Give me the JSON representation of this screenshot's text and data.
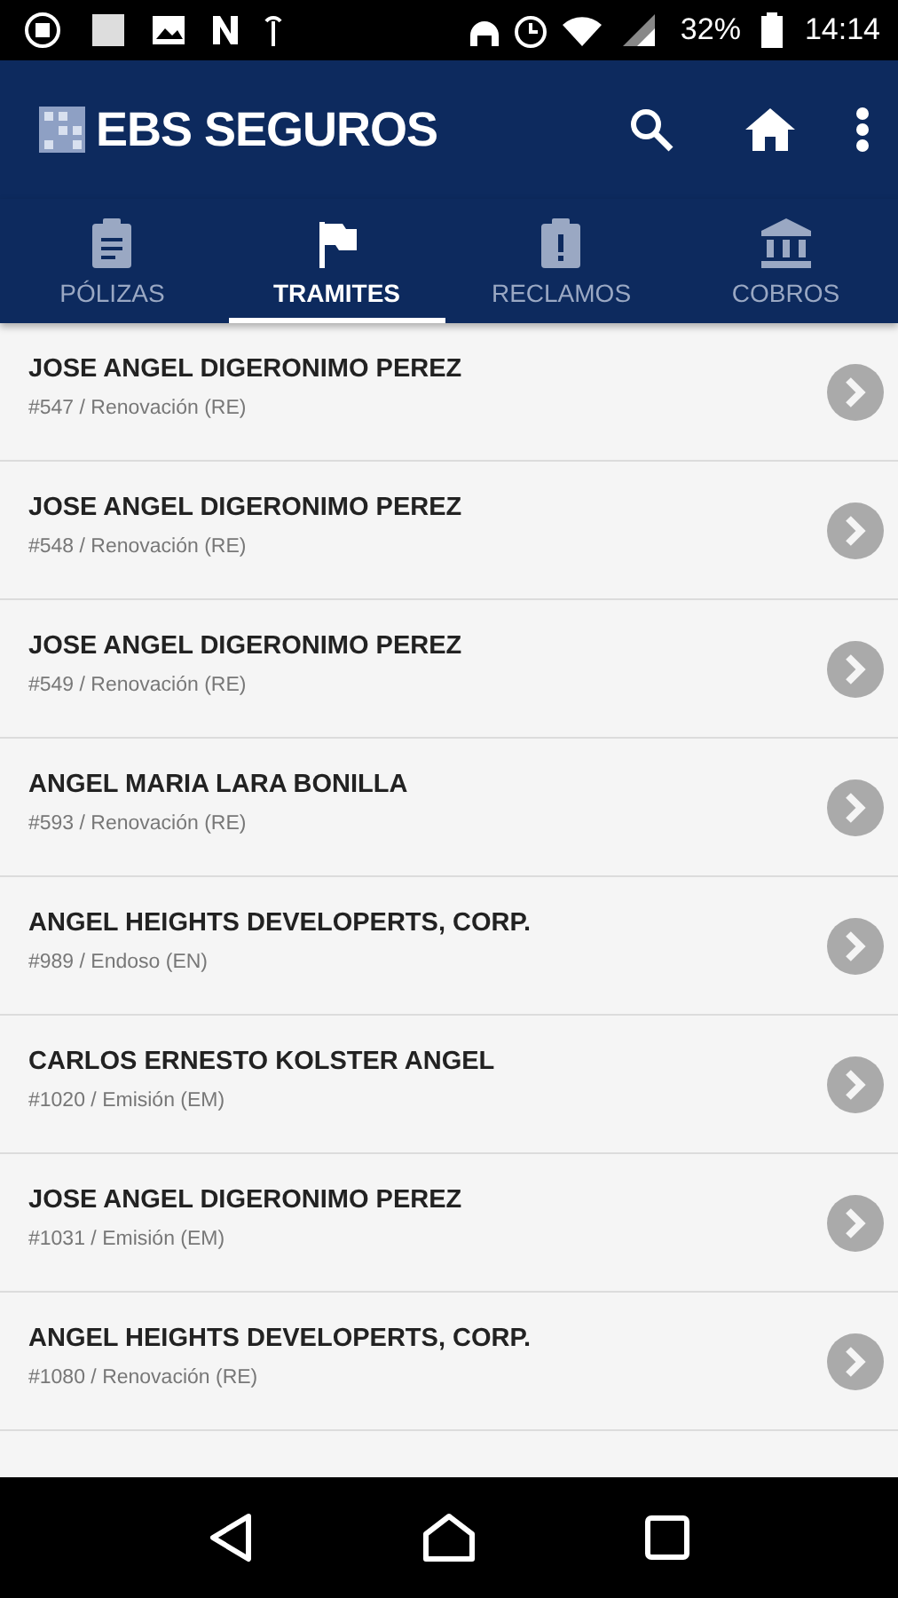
{
  "status_bar": {
    "battery": "32%",
    "time": "14:14"
  },
  "app_bar": {
    "title": "EBS SEGUROS"
  },
  "tabs": [
    {
      "label": "PÓLIZAS",
      "kind": "clipboard",
      "selected": false
    },
    {
      "label": "TRAMITES",
      "kind": "flag",
      "selected": true
    },
    {
      "label": "RECLAMOS",
      "kind": "alert",
      "selected": false
    },
    {
      "label": "COBROS",
      "kind": "bank",
      "selected": false
    }
  ],
  "items": [
    {
      "name": "JOSE ANGEL DIGERONIMO PEREZ",
      "detail": "#547 / Renovación (RE)"
    },
    {
      "name": "JOSE ANGEL DIGERONIMO PEREZ",
      "detail": "#548 / Renovación (RE)"
    },
    {
      "name": "JOSE ANGEL DIGERONIMO PEREZ",
      "detail": "#549 / Renovación (RE)"
    },
    {
      "name": "ANGEL MARIA LARA BONILLA",
      "detail": "#593 / Renovación (RE)"
    },
    {
      "name": "ANGEL HEIGHTS DEVELOPERTS, CORP.",
      "detail": "#989 / Endoso (EN)"
    },
    {
      "name": "CARLOS ERNESTO KOLSTER ANGEL",
      "detail": "#1020 / Emisión (EM)"
    },
    {
      "name": "JOSE ANGEL DIGERONIMO PEREZ",
      "detail": "#1031 / Emisión (EM)"
    },
    {
      "name": "ANGEL HEIGHTS DEVELOPERTS, CORP.",
      "detail": "#1080 / Renovación (RE)"
    }
  ]
}
